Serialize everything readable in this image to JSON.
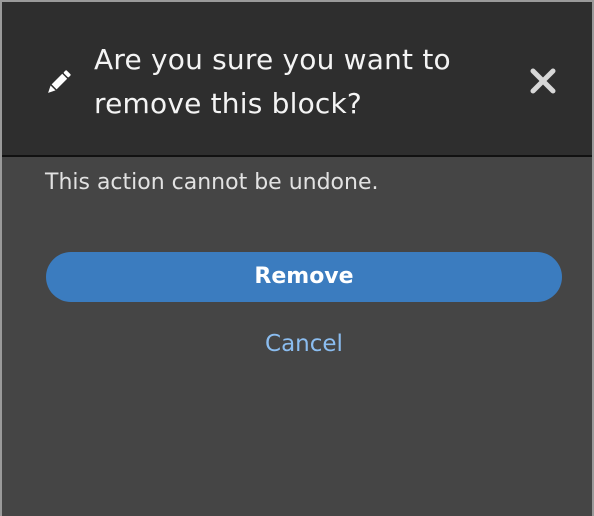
{
  "dialog": {
    "title": "Are you sure you want to remove this block?",
    "message": "This action cannot be undone.",
    "icons": {
      "edit": "pencil-icon",
      "close": "close-icon"
    }
  },
  "actions": {
    "remove_label": "Remove",
    "cancel_label": "Cancel"
  },
  "colors": {
    "header_bg": "#2e2e2e",
    "body_bg": "#454545",
    "primary_button": "#3b7cbf",
    "link": "#8bbdf0"
  }
}
